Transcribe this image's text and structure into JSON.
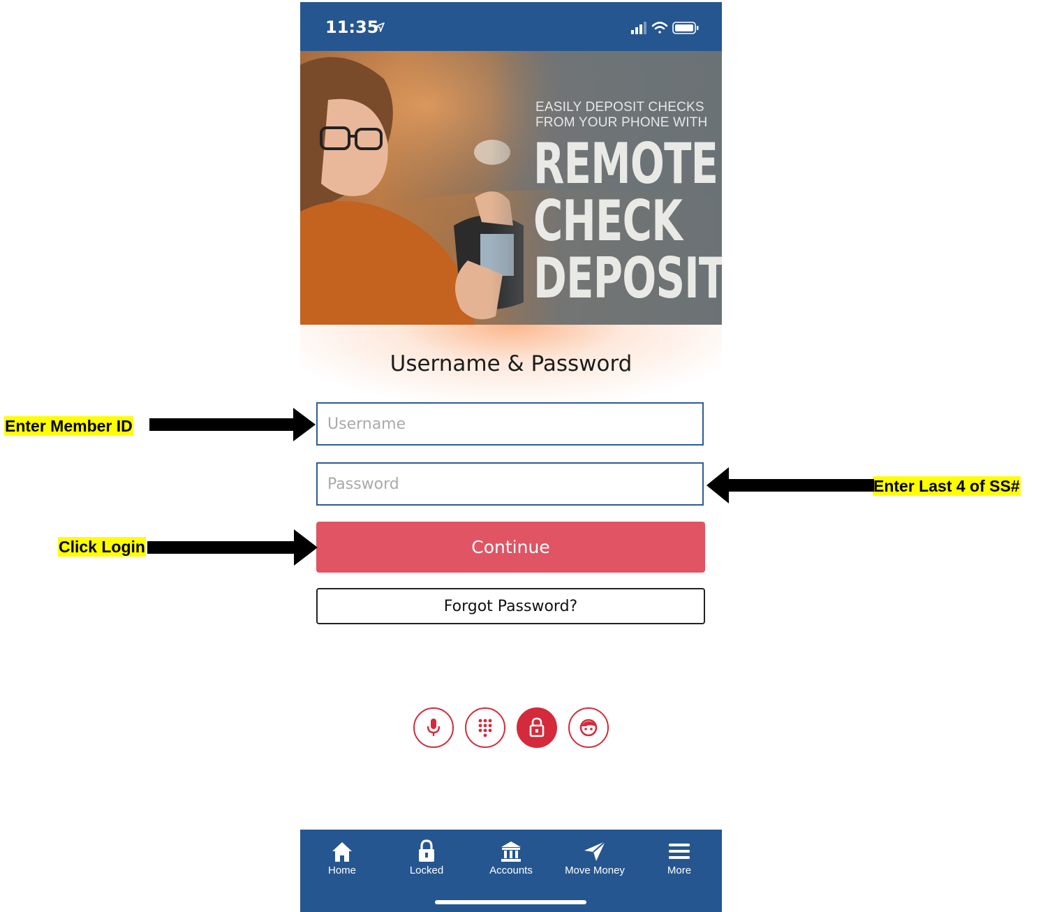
{
  "status_bar": {
    "time": "11:35"
  },
  "banner": {
    "tagline_1": "EASILY DEPOSIT CHECKS",
    "tagline_2": "FROM YOUR PHONE WITH",
    "headline": [
      "REMOTE",
      "CHECK",
      "DEPOSIT"
    ]
  },
  "login": {
    "title": "Username & Password",
    "username_placeholder": "Username",
    "password_placeholder": "Password",
    "continue_label": "Continue",
    "forgot_label": "Forgot Password?",
    "auth_methods": [
      "voice-icon",
      "keypad-icon",
      "lock-icon",
      "face-icon"
    ],
    "accent_color": "#e05463",
    "border_color": "#2f5b92"
  },
  "tab_bar": {
    "items": [
      {
        "label": "Home",
        "icon": "home-icon"
      },
      {
        "label": "Locked",
        "icon": "lock-icon"
      },
      {
        "label": "Accounts",
        "icon": "bank-icon"
      },
      {
        "label": "Move Money",
        "icon": "send-icon"
      },
      {
        "label": "More",
        "icon": "menu-icon"
      }
    ],
    "color": "#255690"
  },
  "annotations": {
    "member_id": "Enter Member ID",
    "last4": "Enter Last 4 of SS#",
    "login": "Click Login",
    "highlight_color": "#ffff00"
  }
}
